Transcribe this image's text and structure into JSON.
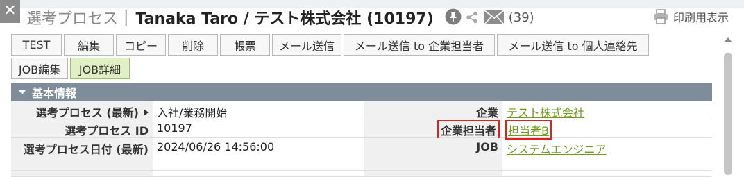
{
  "header": {
    "breadcrumb": "選考プロセス",
    "separator": "|",
    "title": "Tanaka Taro / テスト株式会社 (10197)",
    "mail_count": "(39)",
    "print_label": "印刷用表示"
  },
  "close": {
    "symbol": "✕"
  },
  "toolbar": {
    "row1": [
      "TEST",
      "編集",
      "コピー",
      "削除",
      "帳票",
      "メール送信",
      "メール送信 to 企業担当者",
      "メール送信 to 個人連絡先"
    ],
    "row2": [
      "JOB編集",
      "JOB詳細"
    ],
    "active": "JOB詳細"
  },
  "section": {
    "title": "基本情報"
  },
  "rows": [
    {
      "label_left": "選考プロセス (最新)",
      "value_left": "入社/業務開始",
      "label_right": "企業",
      "value_right": "テスト株式会社"
    },
    {
      "label_left": "選考プロセス ID",
      "value_left": "10197",
      "label_right": "企業担当者",
      "value_right": "担当者B"
    },
    {
      "label_left": "選考プロセス日付 (最新)",
      "value_left": "2024/06/26 14:56:00",
      "label_right": "JOB",
      "value_right": "システムエンジニア"
    }
  ],
  "icons": [
    "close-icon",
    "pin-icon",
    "share-icon",
    "mail-icon",
    "printer-icon",
    "caret-down-icon",
    "caret-right-icon",
    "scroll-up-icon"
  ],
  "colors": {
    "section_bar": "#7f8c99",
    "link": "#6f9b1f",
    "highlight": "#e0201b",
    "active_button": "#e1f0c4"
  }
}
